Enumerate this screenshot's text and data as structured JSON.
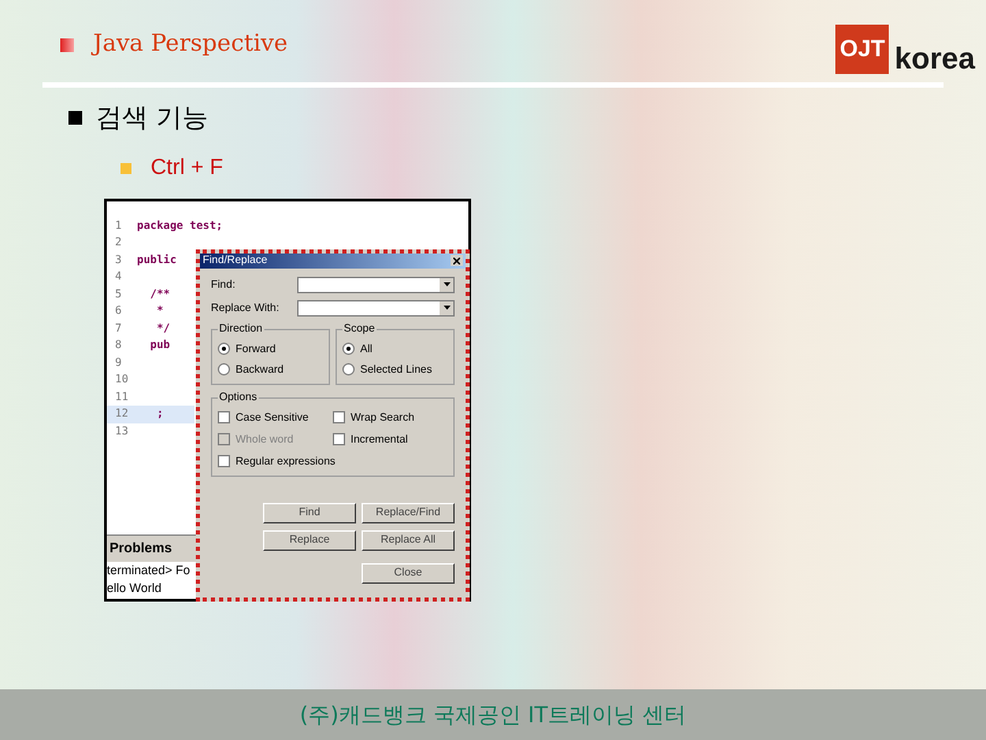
{
  "slide_title": "Java Perspective",
  "heading": "검색 기능",
  "bullet": "Ctrl + F",
  "editor": {
    "lines": [
      {
        "number": "1",
        "code": "package test;",
        "highlighted": false
      },
      {
        "number": "2",
        "highlighted": false
      },
      {
        "number": "3",
        "code": "public",
        "highlighted": false
      },
      {
        "number": "4",
        "highlighted": false
      },
      {
        "number": "5",
        "code": "  /**",
        "highlighted": false
      },
      {
        "number": "6",
        "code": "   *",
        "highlighted": false
      },
      {
        "number": "7",
        "code": "   */",
        "highlighted": false
      },
      {
        "number": "8",
        "code": "  pub",
        "highlighted": false
      },
      {
        "number": "9",
        "highlighted": false
      },
      {
        "number": "10",
        "highlighted": false
      },
      {
        "number": "11",
        "highlighted": false
      },
      {
        "number": "12",
        "code": "   ;",
        "highlighted": true
      },
      {
        "number": "13",
        "highlighted": false
      }
    ],
    "console_tab": "Problems",
    "console_lines": [
      "terminated> Fo",
      "ello World"
    ]
  },
  "dialog": {
    "title": "Find/Replace",
    "find_label": "Find:",
    "replace_label": "Replace With:",
    "direction": {
      "title": "Direction",
      "options": [
        {
          "label": "Forward",
          "selected": true
        },
        {
          "label": "Backward",
          "selected": false
        }
      ]
    },
    "scope": {
      "title": "Scope",
      "options": [
        {
          "label": "All",
          "selected": true
        },
        {
          "label": "Selected Lines",
          "selected": false
        }
      ]
    },
    "options": {
      "title": "Options",
      "items": [
        {
          "label": "Case Sensitive",
          "checked": false,
          "disabled": false
        },
        {
          "label": "Wrap Search",
          "checked": false,
          "disabled": false
        },
        {
          "label": "Whole word",
          "checked": false,
          "disabled": true
        },
        {
          "label": "Incremental",
          "checked": false,
          "disabled": false
        },
        {
          "label": "Regular expressions",
          "checked": false,
          "disabled": false
        }
      ]
    },
    "buttons": [
      {
        "label": "Find",
        "disabled": false
      },
      {
        "label": "Replace/Find",
        "disabled": false
      },
      {
        "label": "Replace",
        "disabled": false
      },
      {
        "label": "Replace All",
        "disabled": false
      },
      {
        "label": "Close",
        "disabled": false
      }
    ]
  },
  "logo": {
    "mark": "OJT",
    "word": "korea"
  },
  "footer": "(주)캐드뱅크 국제공인 IT트레이닝 센터"
}
